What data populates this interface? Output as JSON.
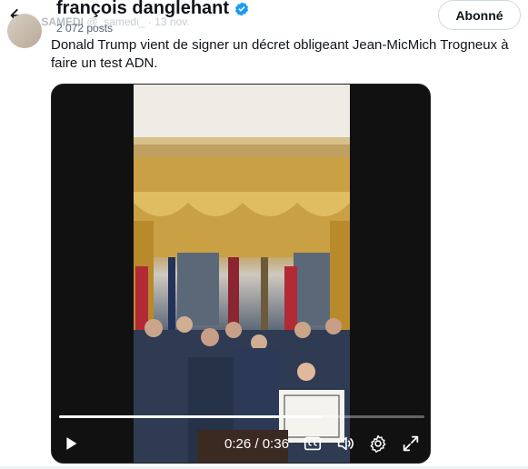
{
  "header": {
    "title": "françois danglehant",
    "posts_count": "2 072 posts",
    "follow_label": "Abonné",
    "ghost_author": "A. SAMEDI",
    "ghost_handle": "@_samedi_ · 13 nov."
  },
  "tweet": {
    "text": "Donald Trump vient de signer un décret obligeant Jean-MicMich Trogneux à faire un test ADN."
  },
  "video": {
    "time_current": "0:26",
    "time_separator": "/",
    "time_total": "0:36",
    "progress_fraction": 0.722
  },
  "icons": {
    "back": "arrow-left-icon",
    "verified": "verified-badge-icon",
    "play": "play-icon",
    "captions": "captions-icon",
    "volume": "volume-icon",
    "settings": "gear-icon",
    "fullscreen": "fullscreen-icon"
  },
  "colors": {
    "accent": "#1d9bf0",
    "text": "#0f1419",
    "muted": "#536471"
  }
}
